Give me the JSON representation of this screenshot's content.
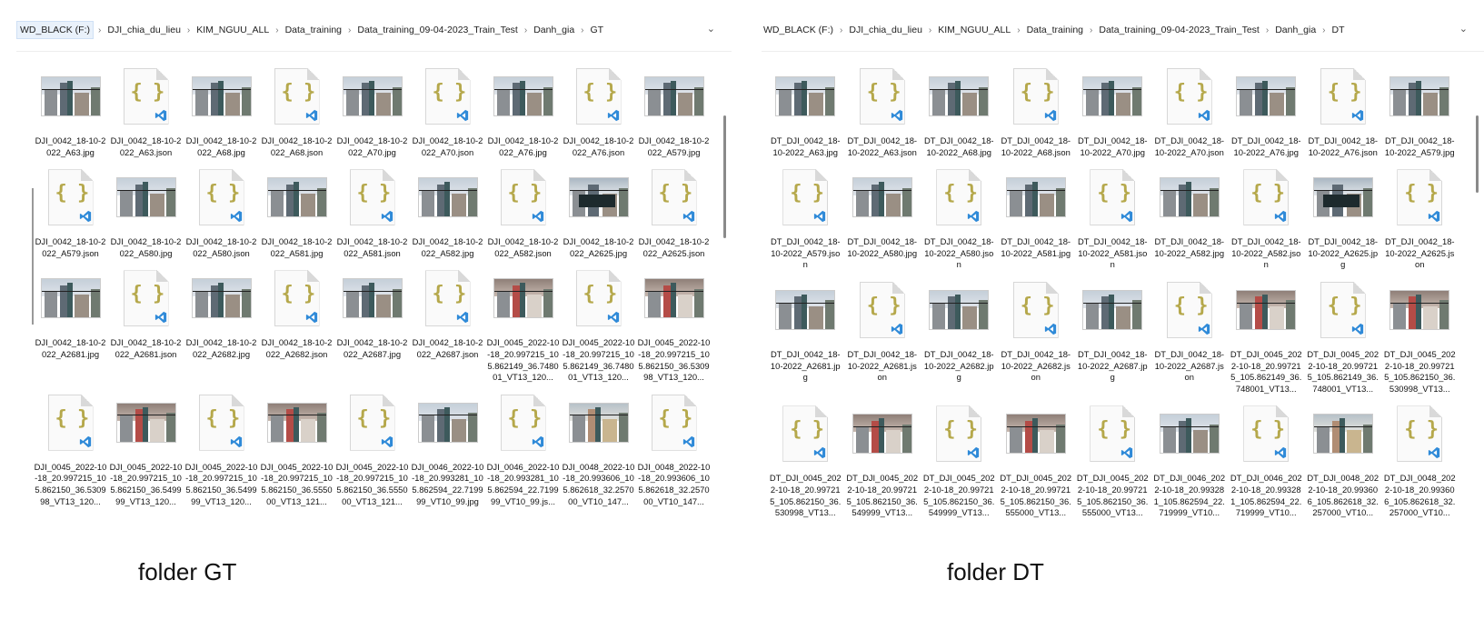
{
  "gt": {
    "breadcrumb": [
      "WD_BLACK (F:)",
      "DJI_chia_du_lieu",
      "KIM_NGUU_ALL",
      "Data_training",
      "Data_training_09-04-2023_Train_Test",
      "Danh_gia",
      "GT"
    ],
    "files": [
      {
        "name": "DJI_0042_18-10-2022_A63.jpg",
        "kind": "photo"
      },
      {
        "name": "DJI_0042_18-10-2022_A63.json",
        "kind": "json"
      },
      {
        "name": "DJI_0042_18-10-2022_A68.jpg",
        "kind": "photo"
      },
      {
        "name": "DJI_0042_18-10-2022_A68.json",
        "kind": "json"
      },
      {
        "name": "DJI_0042_18-10-2022_A70.jpg",
        "kind": "photo"
      },
      {
        "name": "DJI_0042_18-10-2022_A70.json",
        "kind": "json"
      },
      {
        "name": "DJI_0042_18-10-2022_A76.jpg",
        "kind": "photo"
      },
      {
        "name": "DJI_0042_18-10-2022_A76.json",
        "kind": "json"
      },
      {
        "name": "DJI_0042_18-10-2022_A579.jpg",
        "kind": "photo"
      },
      {
        "name": "DJI_0042_18-10-2022_A579.json",
        "kind": "json"
      },
      {
        "name": "DJI_0042_18-10-2022_A580.jpg",
        "kind": "photo"
      },
      {
        "name": "DJI_0042_18-10-2022_A580.json",
        "kind": "json"
      },
      {
        "name": "DJI_0042_18-10-2022_A581.jpg",
        "kind": "photo"
      },
      {
        "name": "DJI_0042_18-10-2022_A581.json",
        "kind": "json"
      },
      {
        "name": "DJI_0042_18-10-2022_A582.jpg",
        "kind": "photo"
      },
      {
        "name": "DJI_0042_18-10-2022_A582.json",
        "kind": "json"
      },
      {
        "name": "DJI_0042_18-10-2022_A2625.jpg",
        "kind": "photo dark"
      },
      {
        "name": "DJI_0042_18-10-2022_A2625.json",
        "kind": "json"
      },
      {
        "name": "DJI_0042_18-10-2022_A2681.jpg",
        "kind": "photo"
      },
      {
        "name": "DJI_0042_18-10-2022_A2681.json",
        "kind": "json"
      },
      {
        "name": "DJI_0042_18-10-2022_A2682.jpg",
        "kind": "photo"
      },
      {
        "name": "DJI_0042_18-10-2022_A2682.json",
        "kind": "json"
      },
      {
        "name": "DJI_0042_18-10-2022_A2687.jpg",
        "kind": "photo"
      },
      {
        "name": "DJI_0042_18-10-2022_A2687.json",
        "kind": "json"
      },
      {
        "name": "DJI_0045_2022-10-18_20.997215_105.862149_36.748001_VT13_120...",
        "kind": "photo red"
      },
      {
        "name": "DJI_0045_2022-10-18_20.997215_105.862149_36.748001_VT13_120...",
        "kind": "json"
      },
      {
        "name": "DJI_0045_2022-10-18_20.997215_105.862150_36.530998_VT13_120...",
        "kind": "photo red"
      },
      {
        "name": "DJI_0045_2022-10-18_20.997215_105.862150_36.530998_VT13_120...",
        "kind": "json"
      },
      {
        "name": "DJI_0045_2022-10-18_20.997215_105.862150_36.549999_VT13_120...",
        "kind": "photo red"
      },
      {
        "name": "DJI_0045_2022-10-18_20.997215_105.862150_36.549999_VT13_120...",
        "kind": "json"
      },
      {
        "name": "DJI_0045_2022-10-18_20.997215_105.862150_36.555000_VT13_121...",
        "kind": "photo red"
      },
      {
        "name": "DJI_0045_2022-10-18_20.997215_105.862150_36.555000_VT13_121...",
        "kind": "json"
      },
      {
        "name": "DJI_0046_2022-10-18_20.993281_105.862594_22.719999_VT10_99.jpg",
        "kind": "photo"
      },
      {
        "name": "DJI_0046_2022-10-18_20.993281_105.862594_22.719999_VT10_99.js...",
        "kind": "json"
      },
      {
        "name": "DJI_0048_2022-10-18_20.993606_105.862618_32.257000_VT10_147...",
        "kind": "photo street"
      },
      {
        "name": "DJI_0048_2022-10-18_20.993606_105.862618_32.257000_VT10_147...",
        "kind": "json"
      }
    ],
    "caption": "folder GT"
  },
  "dt": {
    "breadcrumb": [
      "WD_BLACK (F:)",
      "DJI_chia_du_lieu",
      "KIM_NGUU_ALL",
      "Data_training",
      "Data_training_09-04-2023_Train_Test",
      "Danh_gia",
      "DT"
    ],
    "files": [
      {
        "name": "DT_DJI_0042_18-10-2022_A63.jpg",
        "kind": "photo"
      },
      {
        "name": "DT_DJI_0042_18-10-2022_A63.json",
        "kind": "json"
      },
      {
        "name": "DT_DJI_0042_18-10-2022_A68.jpg",
        "kind": "photo"
      },
      {
        "name": "DT_DJI_0042_18-10-2022_A68.json",
        "kind": "json"
      },
      {
        "name": "DT_DJI_0042_18-10-2022_A70.jpg",
        "kind": "photo"
      },
      {
        "name": "DT_DJI_0042_18-10-2022_A70.json",
        "kind": "json"
      },
      {
        "name": "DT_DJI_0042_18-10-2022_A76.jpg",
        "kind": "photo"
      },
      {
        "name": "DT_DJI_0042_18-10-2022_A76.json",
        "kind": "json"
      },
      {
        "name": "DT_DJI_0042_18-10-2022_A579.jpg",
        "kind": "photo"
      },
      {
        "name": "DT_DJI_0042_18-10-2022_A579.json",
        "kind": "json"
      },
      {
        "name": "DT_DJI_0042_18-10-2022_A580.jpg",
        "kind": "photo"
      },
      {
        "name": "DT_DJI_0042_18-10-2022_A580.json",
        "kind": "json"
      },
      {
        "name": "DT_DJI_0042_18-10-2022_A581.jpg",
        "kind": "photo"
      },
      {
        "name": "DT_DJI_0042_18-10-2022_A581.json",
        "kind": "json"
      },
      {
        "name": "DT_DJI_0042_18-10-2022_A582.jpg",
        "kind": "photo"
      },
      {
        "name": "DT_DJI_0042_18-10-2022_A582.json",
        "kind": "json"
      },
      {
        "name": "DT_DJI_0042_18-10-2022_A2625.jpg",
        "kind": "photo dark"
      },
      {
        "name": "DT_DJI_0042_18-10-2022_A2625.json",
        "kind": "json"
      },
      {
        "name": "DT_DJI_0042_18-10-2022_A2681.jpg",
        "kind": "photo"
      },
      {
        "name": "DT_DJI_0042_18-10-2022_A2681.json",
        "kind": "json"
      },
      {
        "name": "DT_DJI_0042_18-10-2022_A2682.jpg",
        "kind": "photo"
      },
      {
        "name": "DT_DJI_0042_18-10-2022_A2682.json",
        "kind": "json"
      },
      {
        "name": "DT_DJI_0042_18-10-2022_A2687.jpg",
        "kind": "photo"
      },
      {
        "name": "DT_DJI_0042_18-10-2022_A2687.json",
        "kind": "json"
      },
      {
        "name": "DT_DJI_0045_2022-10-18_20.997215_105.862149_36.748001_VT13...",
        "kind": "photo red"
      },
      {
        "name": "DT_DJI_0045_2022-10-18_20.997215_105.862149_36.748001_VT13...",
        "kind": "json"
      },
      {
        "name": "DT_DJI_0045_2022-10-18_20.997215_105.862150_36.530998_VT13...",
        "kind": "photo red"
      },
      {
        "name": "DT_DJI_0045_2022-10-18_20.997215_105.862150_36.530998_VT13...",
        "kind": "json"
      },
      {
        "name": "DT_DJI_0045_2022-10-18_20.997215_105.862150_36.549999_VT13...",
        "kind": "photo red"
      },
      {
        "name": "DT_DJI_0045_2022-10-18_20.997215_105.862150_36.549999_VT13...",
        "kind": "json"
      },
      {
        "name": "DT_DJI_0045_2022-10-18_20.997215_105.862150_36.555000_VT13...",
        "kind": "photo red"
      },
      {
        "name": "DT_DJI_0045_2022-10-18_20.997215_105.862150_36.555000_VT13...",
        "kind": "json"
      },
      {
        "name": "DT_DJI_0046_2022-10-18_20.993281_105.862594_22.719999_VT10...",
        "kind": "photo"
      },
      {
        "name": "DT_DJI_0046_2022-10-18_20.993281_105.862594_22.719999_VT10...",
        "kind": "json"
      },
      {
        "name": "DT_DJI_0048_2022-10-18_20.993606_105.862618_32.257000_VT10...",
        "kind": "photo street"
      },
      {
        "name": "DT_DJI_0048_2022-10-18_20.993606_105.862618_32.257000_VT10...",
        "kind": "json"
      }
    ],
    "caption": "folder DT"
  },
  "icons": {
    "chevron": "chevron-down-icon",
    "separator": "chevron-right-icon",
    "json": "json-file-icon",
    "vscode": "vscode-icon"
  },
  "colors": {
    "brace": "#b5a84b",
    "vscode": "#2f8ad8",
    "breadcrumb_highlight": "#e9f1fb"
  }
}
